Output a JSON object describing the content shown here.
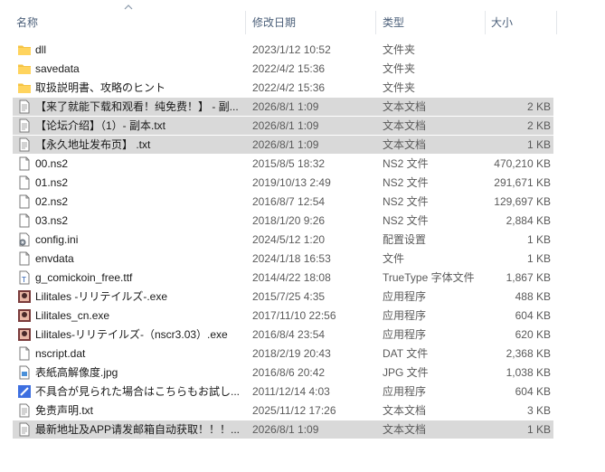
{
  "columns": {
    "name": "名称",
    "date": "修改日期",
    "type": "类型",
    "size": "大小"
  },
  "files": [
    {
      "name": "dll",
      "date": "2023/1/12 10:52",
      "type": "文件夹",
      "size": "",
      "icon": "folder-icon",
      "selected": false
    },
    {
      "name": "savedata",
      "date": "2022/4/2 15:36",
      "type": "文件夹",
      "size": "",
      "icon": "folder-icon",
      "selected": false
    },
    {
      "name": "取扱説明書、攻略のヒント",
      "date": "2022/4/2 15:36",
      "type": "文件夹",
      "size": "",
      "icon": "folder-icon",
      "selected": false
    },
    {
      "name": "【来了就能下载和观看！纯免费！】 - 副...",
      "date": "2026/8/1 1:09",
      "type": "文本文档",
      "size": "2 KB",
      "icon": "text-file-icon",
      "selected": true
    },
    {
      "name": "【论坛介绍】（1）- 副本.txt",
      "date": "2026/8/1 1:09",
      "type": "文本文档",
      "size": "2 KB",
      "icon": "text-file-icon",
      "selected": true
    },
    {
      "name": "【永久地址发布页】 .txt",
      "date": "2026/8/1 1:09",
      "type": "文本文档",
      "size": "1 KB",
      "icon": "text-file-icon",
      "selected": true
    },
    {
      "name": "00.ns2",
      "date": "2015/8/5 18:32",
      "type": "NS2 文件",
      "size": "470,210 KB",
      "icon": "file-icon",
      "selected": false
    },
    {
      "name": "01.ns2",
      "date": "2019/10/13 2:49",
      "type": "NS2 文件",
      "size": "291,671 KB",
      "icon": "file-icon",
      "selected": false
    },
    {
      "name": "02.ns2",
      "date": "2016/8/7 12:54",
      "type": "NS2 文件",
      "size": "129,697 KB",
      "icon": "file-icon",
      "selected": false
    },
    {
      "name": "03.ns2",
      "date": "2018/1/20 9:26",
      "type": "NS2 文件",
      "size": "2,884 KB",
      "icon": "file-icon",
      "selected": false
    },
    {
      "name": "config.ini",
      "date": "2024/5/12 1:20",
      "type": "配置设置",
      "size": "1 KB",
      "icon": "config-file-icon",
      "selected": false
    },
    {
      "name": "envdata",
      "date": "2024/1/18 16:53",
      "type": "文件",
      "size": "1 KB",
      "icon": "file-icon",
      "selected": false
    },
    {
      "name": "g_comickoin_free.ttf",
      "date": "2014/4/22 18:08",
      "type": "TrueType 字体文件",
      "size": "1,867 KB",
      "icon": "font-file-icon",
      "selected": false
    },
    {
      "name": "Lilitales -リリテイルズ-.exe",
      "date": "2015/7/25 4:35",
      "type": "应用程序",
      "size": "488 KB",
      "icon": "app-icon",
      "selected": false
    },
    {
      "name": "Lilitales_cn.exe",
      "date": "2017/11/10 22:56",
      "type": "应用程序",
      "size": "604 KB",
      "icon": "app-icon",
      "selected": false
    },
    {
      "name": "Lilitales-リリテイルズ-（nscr3.03）.exe",
      "date": "2016/8/4 23:54",
      "type": "应用程序",
      "size": "620 KB",
      "icon": "app-icon",
      "selected": false
    },
    {
      "name": "nscript.dat",
      "date": "2018/2/19 20:43",
      "type": "DAT 文件",
      "size": "2,368 KB",
      "icon": "file-icon",
      "selected": false
    },
    {
      "name": "表紙高解像度.jpg",
      "date": "2016/8/6 20:42",
      "type": "JPG 文件",
      "size": "1,038 KB",
      "icon": "image-file-icon",
      "selected": false
    },
    {
      "name": "不具合が見られた場合はこちらもお試し...",
      "date": "2011/12/14 4:03",
      "type": "应用程序",
      "size": "604 KB",
      "icon": "repair-app-icon",
      "selected": false
    },
    {
      "name": "免责声明.txt",
      "date": "2025/11/12 17:26",
      "type": "文本文档",
      "size": "3 KB",
      "icon": "text-file-icon",
      "selected": false
    },
    {
      "name": "最新地址及APP请发邮箱自动获取！！！...",
      "date": "2026/8/1 1:09",
      "type": "文本文档",
      "size": "1 KB",
      "icon": "text-file-icon",
      "selected": true
    }
  ],
  "colors": {
    "selection": "#d9d9d9",
    "folder": "#f5c342",
    "header_text": "#4c607a"
  }
}
